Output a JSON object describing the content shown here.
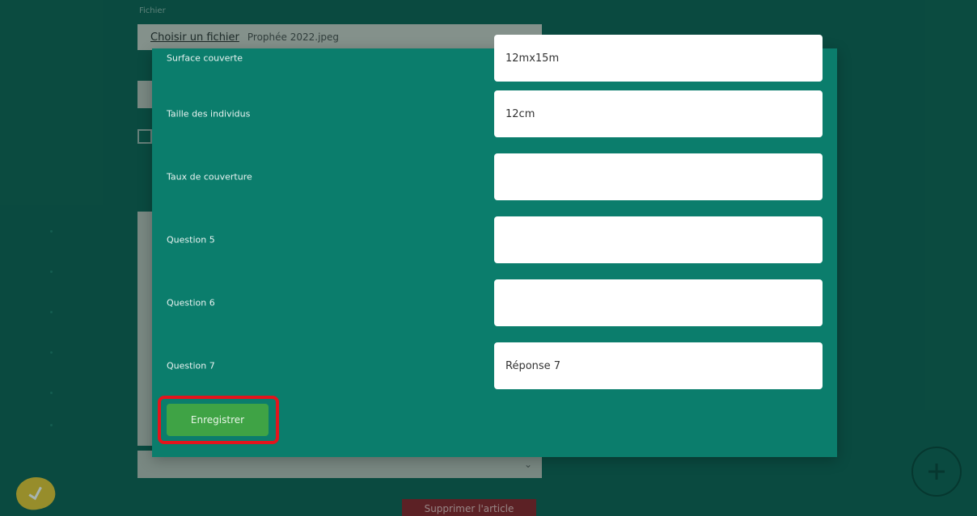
{
  "background": {
    "file_section_label": "Fichier",
    "file_button_label": "Choisir un fichier",
    "file_name": "Prophée 2022.jpeg",
    "unsubscribe_label": "Supprimer l'article",
    "fab_icon": "plus-circle-icon",
    "logo_icon": "checkmark-logo-icon"
  },
  "modal": {
    "fields": [
      {
        "label": "Surface couverte",
        "value": "12mx15m",
        "placeholder": ""
      },
      {
        "label": "Taille des individus",
        "value": "12cm",
        "placeholder": ""
      },
      {
        "label": "Taux de couverture",
        "value": "",
        "placeholder": ""
      },
      {
        "label": "Question 5",
        "value": "",
        "placeholder": ""
      },
      {
        "label": "Question 6",
        "value": "",
        "placeholder": ""
      },
      {
        "label": "Question 7",
        "value": "Réponse 7",
        "placeholder": ""
      }
    ],
    "save_label": "Enregistrer"
  },
  "colors": {
    "background": "#0f5d50",
    "modal": "#0b7d6c",
    "save_button": "#3fa345",
    "highlight": "#e3141c"
  }
}
